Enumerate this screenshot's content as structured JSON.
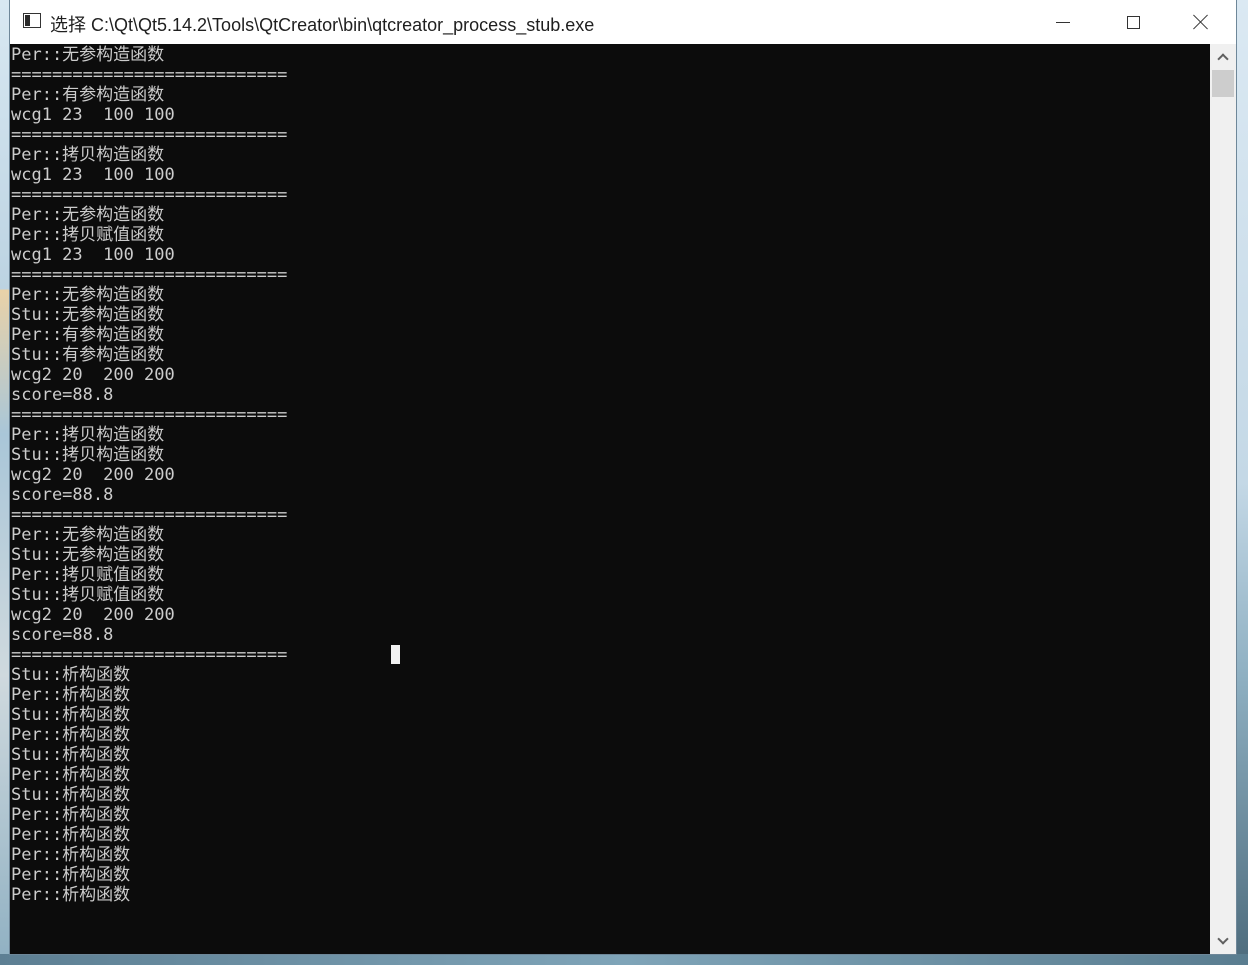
{
  "window": {
    "title": "选择 C:\\Qt\\Qt5.14.2\\Tools\\QtCreator\\bin\\qtcreator_process_stub.exe",
    "controls": {
      "minimize": "minimize",
      "maximize": "maximize",
      "close": "close"
    }
  },
  "console": {
    "background": "#0c0c0c",
    "foreground": "#cccccc",
    "lines": [
      "Per::无参构造函数",
      "===========================",
      "Per::有参构造函数",
      "wcg1 23  100 100",
      "===========================",
      "Per::拷贝构造函数",
      "wcg1 23  100 100",
      "===========================",
      "Per::无参构造函数",
      "Per::拷贝赋值函数",
      "wcg1 23  100 100",
      "===========================",
      "Per::无参构造函数",
      "Stu::无参构造函数",
      "Per::有参构造函数",
      "Stu::有参构造函数",
      "wcg2 20  200 200",
      "score=88.8",
      "===========================",
      "Per::拷贝构造函数",
      "Stu::拷贝构造函数",
      "wcg2 20  200 200",
      "score=88.8",
      "===========================",
      "Per::无参构造函数",
      "Stu::无参构造函数",
      "Per::拷贝赋值函数",
      "Stu::拷贝赋值函数",
      "wcg2 20  200 200",
      "score=88.8",
      "===========================",
      "Stu::析构函数",
      "Per::析构函数",
      "Stu::析构函数",
      "Per::析构函数",
      "Stu::析构函数",
      "Per::析构函数",
      "Stu::析构函数",
      "Per::析构函数",
      "Per::析构函数",
      "Per::析构函数",
      "Per::析构函数",
      "Per::析构函数"
    ]
  },
  "scrollbar": {
    "position": 0.0
  }
}
